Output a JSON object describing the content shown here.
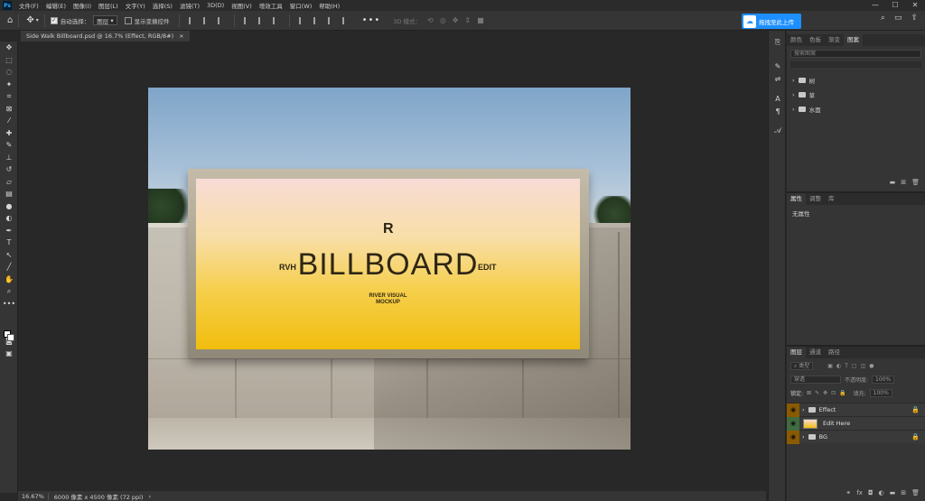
{
  "app": {
    "logo": "Ps"
  },
  "menu": [
    "文件(F)",
    "编辑(E)",
    "图像(I)",
    "图层(L)",
    "文字(Y)",
    "选择(S)",
    "滤镜(T)",
    "3D(D)",
    "视图(V)",
    "增效工具",
    "窗口(W)",
    "帮助(H)"
  ],
  "window_controls": {
    "minimize": "—",
    "maximize": "☐",
    "close": "✕"
  },
  "options": {
    "auto_select_label": "自动选择：",
    "auto_select_target": "图层",
    "show_transform_label": "显示变换控件",
    "mode_3d_label": "3D 模式：",
    "more": "•••"
  },
  "upload": {
    "label": "拖拽至此上传"
  },
  "document": {
    "tab_title": "Side Walk Billboard.psd @ 16.7% (Effect, RGB/8#)",
    "close": "×"
  },
  "billboard": {
    "logo": "R",
    "title": "BILLBOARD",
    "left": "RVH",
    "right": "EDIT",
    "sub_line1": "RIVER VISUAL",
    "sub_line2": "MOCKUP"
  },
  "status": {
    "zoom": "16.67%",
    "info": "6000 像素 x 4500 像素 (72 ppi)"
  },
  "panel_top": {
    "tabs": [
      "颜色",
      "色板",
      "渐变",
      "图案"
    ],
    "active_tab": 3,
    "search_placeholder": "搜索图案",
    "groups": [
      "树",
      "草",
      "水面"
    ]
  },
  "panel_props": {
    "tabs": [
      "属性",
      "调整",
      "库"
    ],
    "active_tab": 0,
    "empty_text": "无属性"
  },
  "panel_layers": {
    "tabs": [
      "图层",
      "通道",
      "路径"
    ],
    "active_tab": 0,
    "filter_label": "类型",
    "blend_mode": "穿透",
    "opacity_label": "不透明度:",
    "opacity_value": "100%",
    "lock_label": "锁定:",
    "fill_label": "填充:",
    "fill_value": "100%",
    "layers": [
      {
        "name": "Effect",
        "type": "group",
        "locked": true
      },
      {
        "name": "Edit Here",
        "type": "smart",
        "locked": false
      },
      {
        "name": "BG",
        "type": "group",
        "locked": true
      }
    ]
  }
}
